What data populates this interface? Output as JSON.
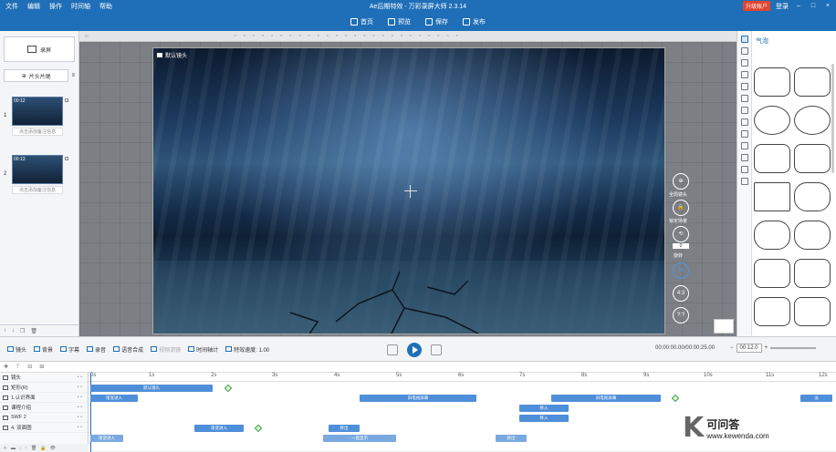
{
  "titlebar": {
    "menus": [
      "文件",
      "编辑",
      "操作",
      "时间轴",
      "帮助"
    ],
    "title": "Ae后期特效 - 万彩录屏大师 2.3.14",
    "upgrade": "升级账户",
    "login": "登录"
  },
  "toolbar": {
    "home": "首页",
    "preview": "预览",
    "save": "保存",
    "publish": "发布"
  },
  "left_panel": {
    "lens_label": "录屏",
    "template_label": "片头片尾",
    "scenes": [
      {
        "num": "1",
        "time": "00:12",
        "note": "点击添加备注信息"
      },
      {
        "num": "2",
        "time": "00:13",
        "note": "点击添加备注信息"
      }
    ],
    "add_scene": "+"
  },
  "stage": {
    "label": "默认镜头"
  },
  "right_tools": {
    "global_lens": "全局镜头",
    "lock_scene": "锁定场景",
    "rotate": "旋转",
    "rotate_value": "0",
    "ratio_43": "4:3",
    "ratio_custom": "?:?"
  },
  "right_panel": {
    "header": "气泡"
  },
  "playbar": {
    "items": [
      "镜头",
      "背景",
      "字幕",
      "录音",
      "语音合成",
      "视频滤镜",
      "时间轴计",
      "特效速度: 1.00"
    ],
    "timecode": "00:00:00.00/00:00:25.00",
    "zoom": "00:12.0"
  },
  "timeline": {
    "ruler": [
      "0s",
      "1s",
      "2s",
      "3s",
      "4s",
      "5s",
      "6s",
      "7s",
      "8s",
      "9s",
      "10s",
      "11s",
      "12s"
    ],
    "tracks": [
      {
        "label": "镜头"
      },
      {
        "label": "矩形(R)"
      },
      {
        "label": "1.认识界面"
      },
      {
        "label": "课程介绍"
      },
      {
        "label": "SWF 2"
      },
      {
        "label": "4. 双面图"
      }
    ],
    "clips": {
      "lens": "默认镜头",
      "rect_a": "渐变进入",
      "rect_b": "旧电视屏幕",
      "rect_c": "旧电视屏幕",
      "rect_d": "淡",
      "t3_a": "移入",
      "t4_a": "移入",
      "t5_a": "渐变进入",
      "t5_b": "移出",
      "t6_a": "渐变进入",
      "t6_b": "一直显示",
      "t6_c": "移出"
    }
  },
  "watermark": {
    "letter": "K",
    "line1": "可问答",
    "line2": "www.kewenda.com"
  }
}
